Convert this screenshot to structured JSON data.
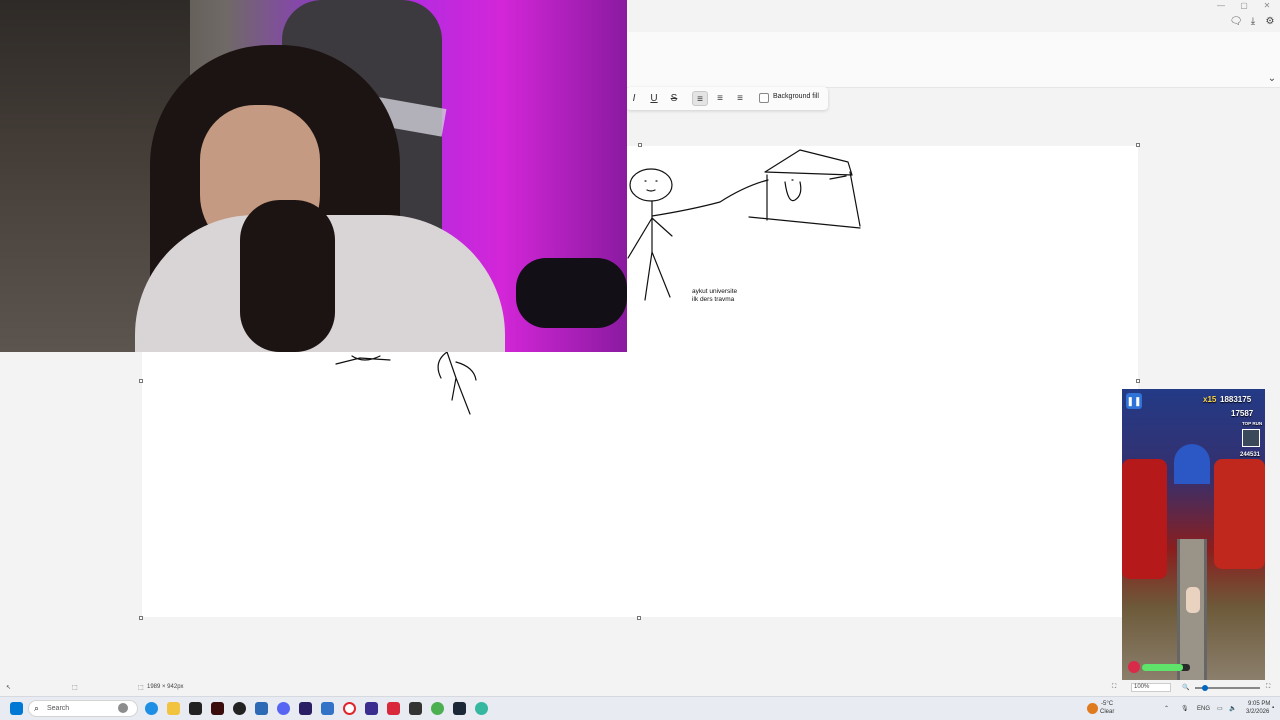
{
  "window": {
    "controls": [
      "—",
      "▢",
      "✕"
    ]
  },
  "header": {
    "icons": [
      "feedback-icon",
      "download-icon",
      "settings-icon",
      "chevron-down-icon"
    ]
  },
  "text_toolbar": {
    "italic": "I",
    "underline": "U",
    "strikethrough": "S",
    "align_left": "≡",
    "align_center": "≡",
    "align_right": "≡",
    "background_fill_label": "Background fill"
  },
  "canvas": {
    "note_line1": "aykut universite",
    "note_line2": "ilk ders travma"
  },
  "statusbar": {
    "pointer_readout": "",
    "canvas_size": "1989 × 942px",
    "zoom": "100%"
  },
  "taskbar": {
    "search_placeholder": "Search",
    "weather_temp": "-5°C",
    "weather_desc": "Clear",
    "language": "ENG",
    "time": "9:05 PM",
    "date": "3/2/2026"
  },
  "game": {
    "multiplier": "x15",
    "score": "1883175",
    "coins": "17587",
    "top_run_label": "TOP RUN",
    "top_run_value": "244531"
  },
  "colors": {
    "accent": "#0067c0",
    "canvas_bg": "#ffffff",
    "app_bg": "#f3f3f3"
  }
}
